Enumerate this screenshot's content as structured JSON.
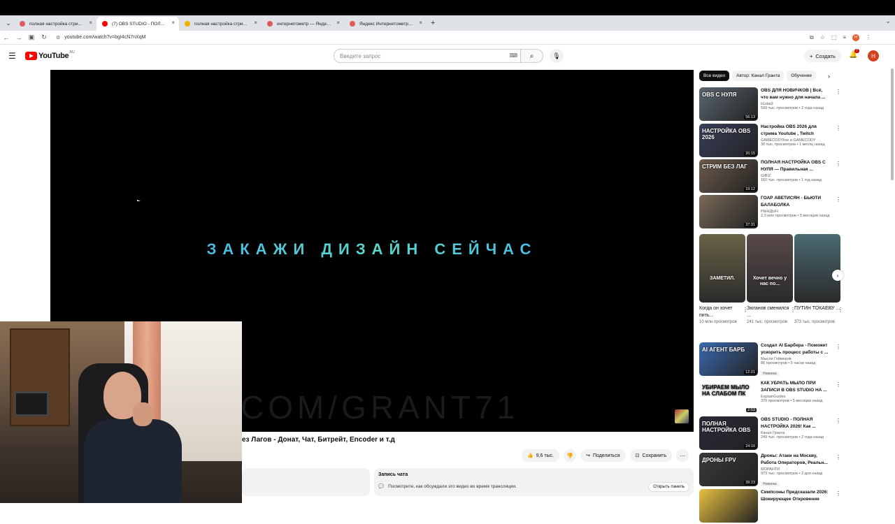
{
  "tabs": [
    {
      "title": "полная настройка стрима от а",
      "favicon_color": "#e05a5a",
      "active": false
    },
    {
      "title": "(7) OBS STUDIO - ПОЛНАЯ НА",
      "favicon_color": "#ff0000",
      "active": true
    },
    {
      "title": "полная настройка стрима от а",
      "favicon_color": "#f0b400",
      "active": false
    },
    {
      "title": "интернетометр — Яндекс нал",
      "favicon_color": "#e05a5a",
      "active": false
    },
    {
      "title": "Яндекс Интернетометр — про",
      "favicon_color": "#e05a5a",
      "active": false
    }
  ],
  "browser": {
    "url": "youtube.com/watch?v=bgI4cN7nXqM",
    "new_tab_glyph": "+",
    "tab_close_glyph": "×"
  },
  "youtube": {
    "logo_text": "YouTube",
    "logo_region": "RU",
    "search_placeholder": "Введите запрос",
    "create_label": "Создать",
    "notif_count": "7",
    "avatar_letter": "Н"
  },
  "player": {
    "promo_text": "ЗАКАЖИ ДИЗАЙН СЕЙЧАС",
    "watermark_text": "COM/GRANT71"
  },
  "video": {
    "title_visible": "ез Лагов - Донат, Чат, Битрейт, Encoder и т.д",
    "likes": "9,6 тыс.",
    "share_label": "Поделиться",
    "save_label": "Сохранить"
  },
  "chat_replay": {
    "title": "Запись чата",
    "description": "Посмотрите, как обсуждали это видео во время трансляции.",
    "open_label": "Открыть панель"
  },
  "chips": [
    "Все видео",
    "Автор: Канал Гранта",
    "Обучение"
  ],
  "recommendations": [
    {
      "title": "OBS ДЛЯ НОВИЧКОВ | Всё, что вам нужно для начала ...",
      "channel": "b1stai3",
      "meta": "599 тыс. просмотров • 2 года назад",
      "duration": "56:13",
      "thumb_text": "OBS С НУЛЯ",
      "bg": "#5b6670"
    },
    {
      "title": "Настройка OBS 2026 для стрима Youtube , Twitch",
      "channel": "GAMECODYlive и GAMECODY",
      "meta": "30 тыс. просмотров • 1 месяц назад",
      "duration": "20:15",
      "thumb_text": "НАСТРОЙКА OBS 2026",
      "bg": "#3a3f5a"
    },
    {
      "title": "ПОЛНАЯ НАСТРОЙКА OBS С НУЛЯ — Правильная ...",
      "channel": "GIBIZ",
      "meta": "160 тыс. просмотров • 1 год назад",
      "duration": "19:12",
      "thumb_text": "СТРИМ БЕЗ ЛАГ",
      "bg": "#6c5a4c"
    },
    {
      "title": "ГОАР АВЕТИСЯН - БЬЮТИ БАЛАБОЛКА",
      "channel": "РЫНДЫЧ",
      "meta": "2,3 млн просмотров • 5 месяцев назад",
      "duration": "37:31",
      "thumb_text": "",
      "bg": "#7a6a5a"
    }
  ],
  "shorts": [
    {
      "title": "Когда он хочет пить...",
      "views": "10 млн просмотров",
      "thumb_text": "ЗАМЕТИЛ.",
      "bg": "#6a6448"
    },
    {
      "title": "Зюганов сменился ...",
      "views": "241 тыс. просмотров",
      "thumb_text": "Хочет вечно у нас по...",
      "bg": "#5a4a4a"
    },
    {
      "title": "ПУТИН ТОКАЕВУ ...",
      "views": "373 тыс. просмотров",
      "thumb_text": "",
      "bg": "#4a6a72"
    }
  ],
  "recommendations2": [
    {
      "title": "Создал AI Барбера - Поможет ускорить процесс работы с ...",
      "channel": "Мысли Геймеров",
      "meta": "86 просмотров • 5 часов назад",
      "duration": "12:21",
      "badge": "Новинка",
      "thumb_text": "AI АГЕНТ БАРБ",
      "bg": "#3a6ab0"
    },
    {
      "title": "КАК УБРАТЬ МЫЛО ПРИ ЗАПИСИ В OBS STUDIO НА ...",
      "channel": "ExplainGuides",
      "meta": "370 просмотров • 5 месяцев назад",
      "duration": "2:53",
      "badge": "",
      "thumb_text": "УБИРАЕМ МЫЛО НА СЛАБОМ ПК",
      "bg": "#ffffff"
    },
    {
      "title": "OBS STUDIO - ПОЛНАЯ НАСТРОЙКА 2026! Как ...",
      "channel": "Канал Гранта",
      "meta": "249 тыс. просмотров • 2 года назад",
      "duration": "24:10",
      "badge": "",
      "thumb_text": "ПОЛНАЯ НАСТРОЙКА OBS",
      "bg": "#2a2a3a"
    },
    {
      "title": "Дроны: Атаки на Москву, Работа Операторов, Реальн...",
      "channel": "МОРАНТИ",
      "meta": "973 тыс. просмотров • 2 дня назад",
      "duration": "39:23",
      "badge": "Новинка",
      "thumb_text": "ДРОНЫ FPV",
      "bg": "#3a3a3a"
    },
    {
      "title": "Симпсоны Предсказали 2026: Шокирующее Откровение",
      "channel": "",
      "meta": "",
      "duration": "",
      "badge": "",
      "thumb_text": "",
      "bg": "#e8c040"
    }
  ]
}
